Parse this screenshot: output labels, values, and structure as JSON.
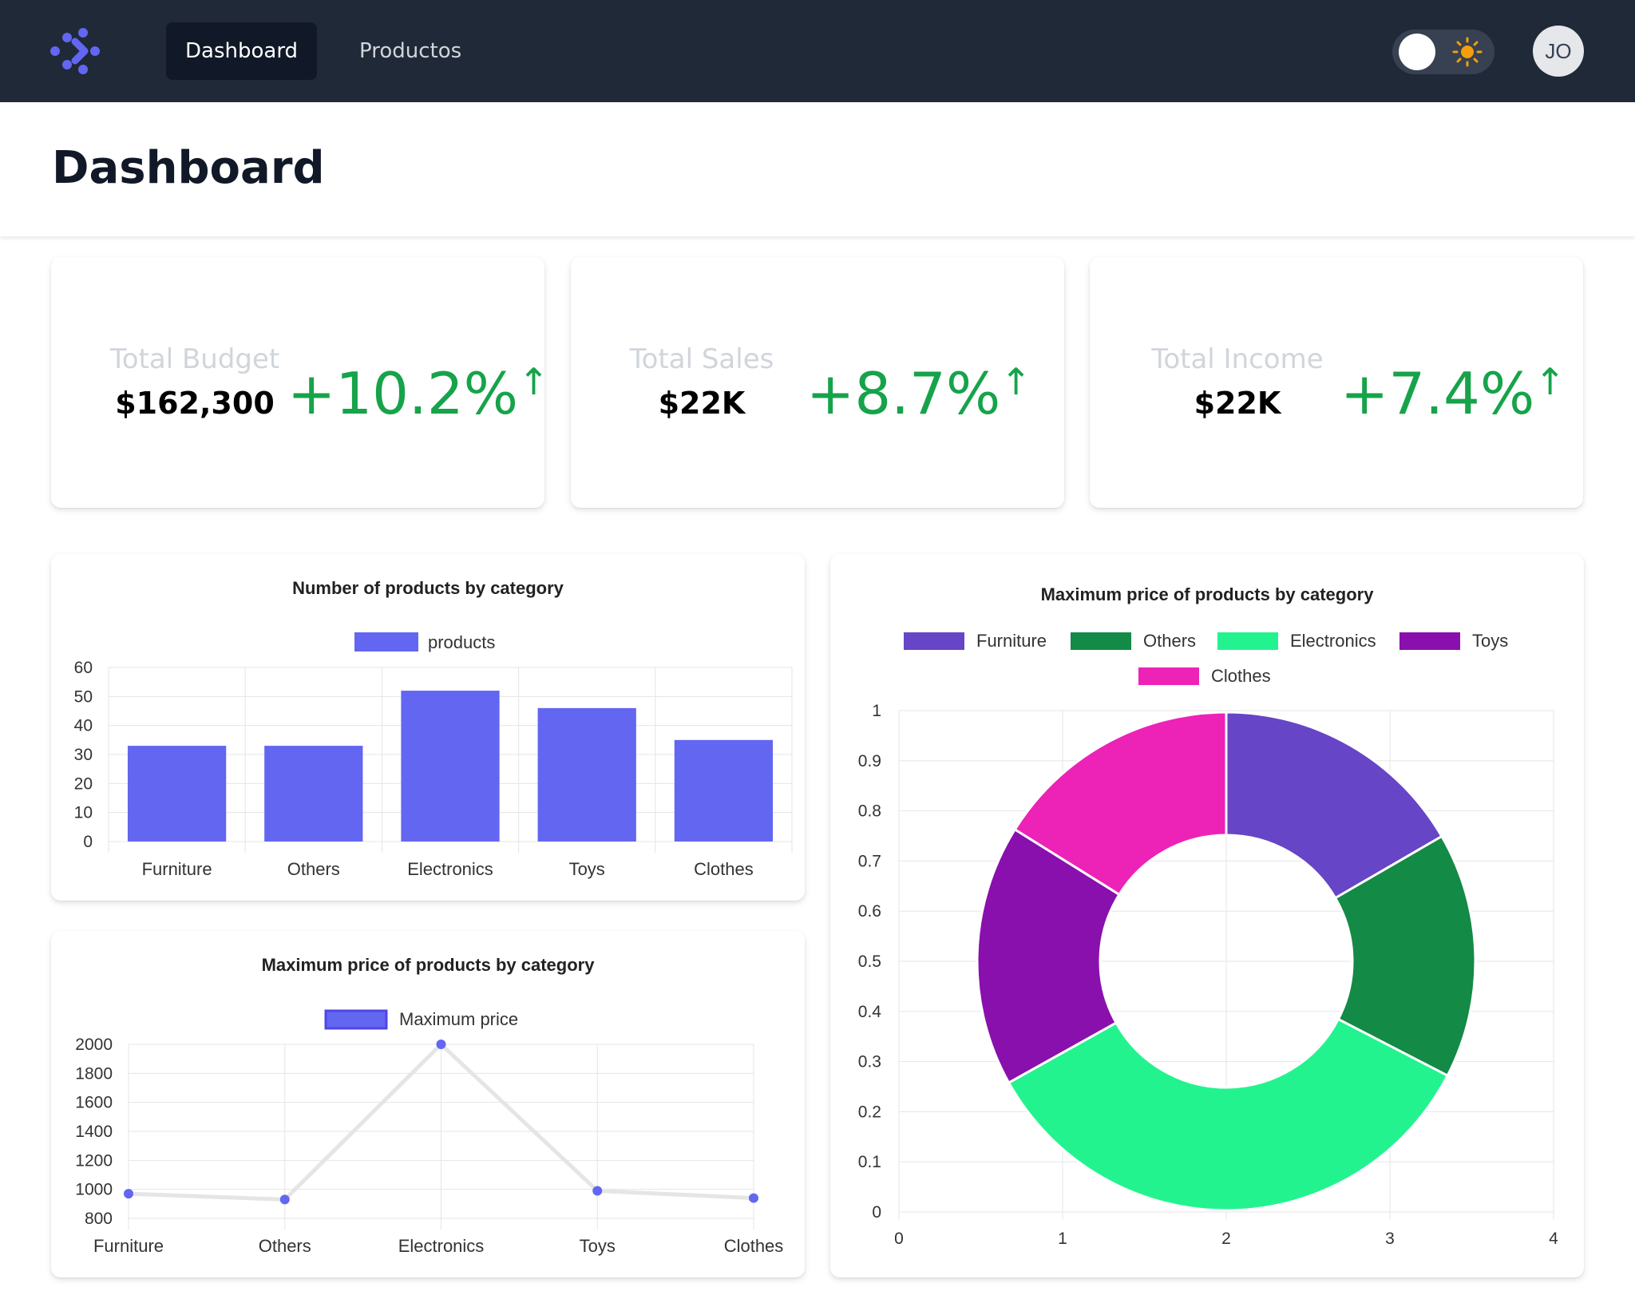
{
  "nav": {
    "items": [
      {
        "label": "Dashboard"
      },
      {
        "label": "Productos"
      }
    ]
  },
  "user": {
    "initials": "JO"
  },
  "page": {
    "title": "Dashboard"
  },
  "stats": [
    {
      "label": "Total Budget",
      "value": "$162,300",
      "change": "+10.2%",
      "arrow": "↑"
    },
    {
      "label": "Total Sales",
      "value": "$22K",
      "change": "+8.7%",
      "arrow": "↑"
    },
    {
      "label": "Total Income",
      "value": "$22K",
      "change": "+7.4%",
      "arrow": "↑"
    }
  ],
  "colors": {
    "topbar": "#1f2937",
    "accent": "#6366f1",
    "positive": "#16a34a",
    "sun": "#f59e0b"
  },
  "icons": {
    "logo": "logo-icon",
    "theme": "sun-icon"
  },
  "chart_data": [
    {
      "type": "bar",
      "title": "Number of products by category",
      "categories": [
        "Furniture",
        "Others",
        "Electronics",
        "Toys",
        "Clothes"
      ],
      "series": [
        {
          "name": "products",
          "values": [
            33,
            33,
            52,
            46,
            35
          ],
          "color": "#6366f1"
        }
      ],
      "ylim": [
        0,
        60
      ],
      "yticks": [
        0,
        10,
        20,
        30,
        40,
        50,
        60
      ],
      "grid": true,
      "legend": "top"
    },
    {
      "type": "line",
      "title": "Maximum price of products by category",
      "categories": [
        "Furniture",
        "Others",
        "Electronics",
        "Toys",
        "Clothes"
      ],
      "series": [
        {
          "name": "Maximum price",
          "values": [
            970,
            930,
            2000,
            990,
            940
          ],
          "color": "#6366f1",
          "line_color": "#e5e5e5"
        }
      ],
      "ylim": [
        800,
        2000
      ],
      "yticks": [
        800,
        1000,
        1200,
        1400,
        1600,
        1800,
        2000
      ],
      "grid": true,
      "legend": "top"
    },
    {
      "type": "pie",
      "title": "Maximum price of products by category",
      "labels": [
        "Furniture",
        "Others",
        "Electronics",
        "Toys",
        "Clothes"
      ],
      "values": [
        970,
        930,
        2000,
        990,
        940
      ],
      "colors": [
        "#6645c6",
        "#138a46",
        "#23f38f",
        "#8910ac",
        "#ed22b6"
      ],
      "xlim": [
        0,
        4
      ],
      "xticks": [
        0,
        1,
        2,
        3,
        4
      ],
      "ylim": [
        0,
        1
      ],
      "yticks": [
        0,
        0.1,
        0.2,
        0.3,
        0.4,
        0.5,
        0.6,
        0.7,
        0.8,
        0.9,
        1
      ],
      "grid": true,
      "legend": "top"
    }
  ]
}
